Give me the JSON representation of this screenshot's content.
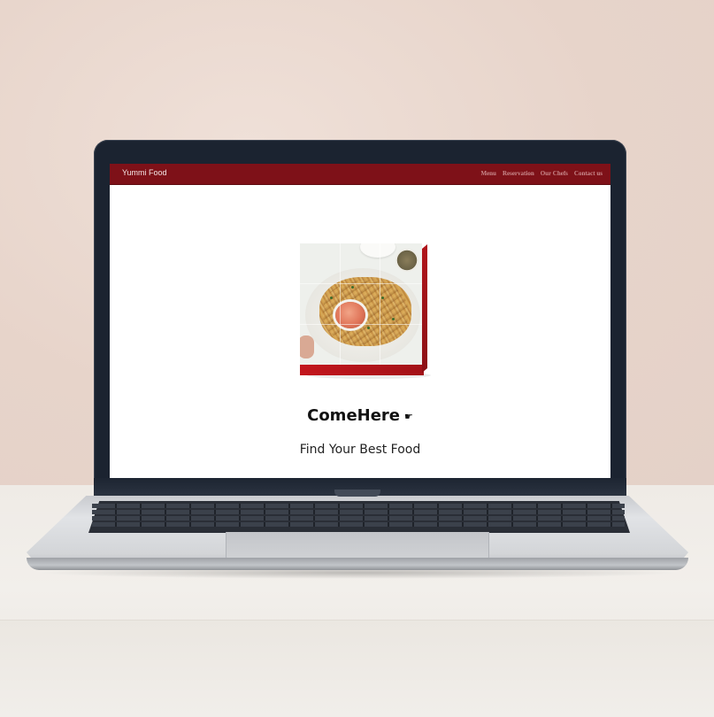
{
  "site": {
    "brand": "Yummi Food",
    "nav": [
      {
        "label": "Menu"
      },
      {
        "label": "Reservation"
      },
      {
        "label": "Our Chefs"
      },
      {
        "label": "Contact us"
      }
    ],
    "accent_color": "#7e1118"
  },
  "hero": {
    "title": "ComeHere",
    "title_icon": "pointing-hand-icon",
    "subtitle": "Find Your Best Food",
    "image_icon": "food-plate-image"
  }
}
